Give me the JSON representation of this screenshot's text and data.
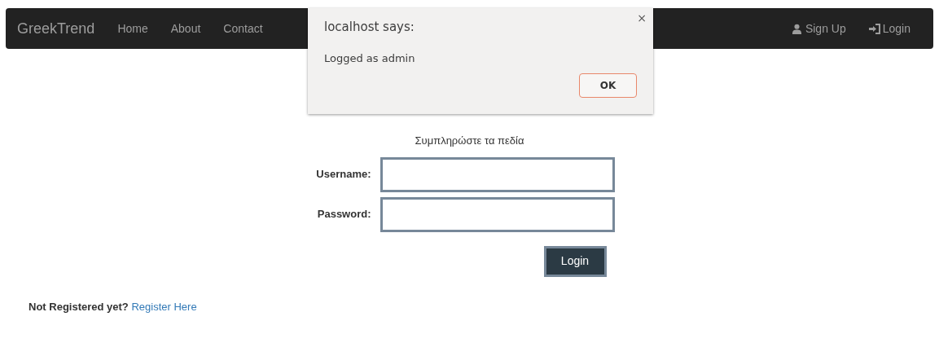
{
  "navbar": {
    "brand": "GreekTrend",
    "links": [
      {
        "label": "Home"
      },
      {
        "label": "About"
      },
      {
        "label": "Contact"
      }
    ],
    "right_links": [
      {
        "label": "Sign Up",
        "kind": "user"
      },
      {
        "label": "Login",
        "kind": "login"
      }
    ]
  },
  "form": {
    "subtitle": "Συμπληρώστε τα πεδία",
    "fields": [
      {
        "label": "Username:"
      },
      {
        "label": "Password:"
      }
    ],
    "submit": "Login"
  },
  "footer": {
    "question": "Not Registered yet?",
    "link": "Register Here"
  },
  "alert": {
    "title": "localhost says:",
    "message": "Logged as admin",
    "close": "×",
    "button": "OK"
  }
}
